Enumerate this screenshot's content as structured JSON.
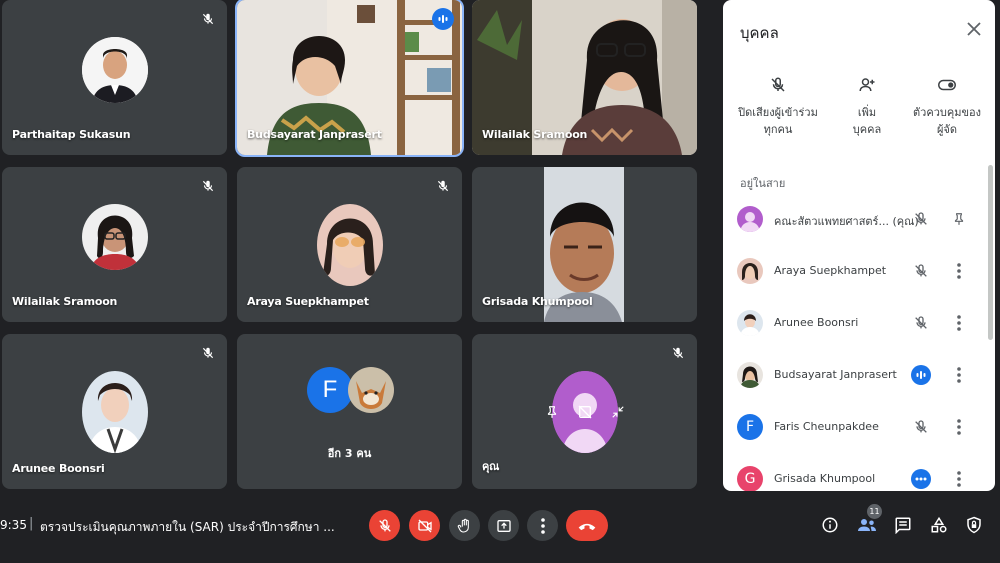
{
  "tiles": {
    "t1": {
      "name": "Parthaitap Sukasun"
    },
    "t2": {
      "name": "Budsayarat Janprasert"
    },
    "t3": {
      "name": "Wilailak Sramoon"
    },
    "t4": {
      "name": "Wilailak Sramoon"
    },
    "t5": {
      "name": "Araya Suepkhampet"
    },
    "t6": {
      "name": "Grisada Khumpool"
    },
    "t7": {
      "name": "Arunee Boonsri"
    },
    "t8": {
      "more_label": "อีก 3 คน",
      "avatar_letter": "F"
    },
    "t9": {
      "name": "คุณ"
    }
  },
  "panel": {
    "title": "บุคคล",
    "actions": [
      {
        "label1": "ปิดเสียงผู้เข้าร่วม",
        "label2": "ทุกคน",
        "icon": "mic-off-icon"
      },
      {
        "label1": "เพิ่ม",
        "label2": "บุคคล",
        "icon": "add-person-icon"
      },
      {
        "label1": "ตัวควบคุมของ",
        "label2": "ผู้จัด",
        "icon": "toggle-icon"
      }
    ],
    "section": "อยู่ในสาย",
    "people": [
      {
        "name": "คณะสัตวแพทยศาสตร์...",
        "suffix": "(คุณ)",
        "avatar_color": "#b15dcc"
      },
      {
        "name": "Araya Suepkhampet"
      },
      {
        "name": "Arunee Boonsri"
      },
      {
        "name": "Budsayarat Janprasert"
      },
      {
        "name": "Faris Cheunpakdee",
        "letter": "F",
        "avatar_color": "#1a73e8"
      },
      {
        "name": "Grisada Khumpool",
        "letter": "G",
        "avatar_color": "#e8436b"
      }
    ]
  },
  "bottom": {
    "time": "9:35",
    "separator": "|",
    "title": "ตรวจประเมินคุณภาพภายใน (SAR) ประจำปีการศึกษา ...",
    "participants_count": "11"
  },
  "colors": {
    "accent": "#1a73e8",
    "danger": "#ea4335",
    "tile": "#3c4043",
    "background": "#202124"
  }
}
